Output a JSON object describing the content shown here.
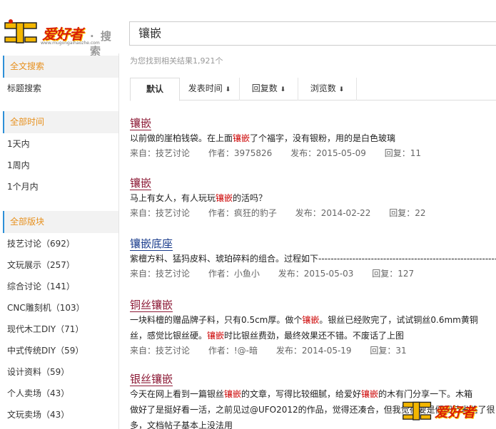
{
  "header": {
    "logo_text": "爱好者",
    "logo_url": "www.mugongaihaozhe.com",
    "search_label": "搜索",
    "search_value": "镶嵌"
  },
  "result_info": "为您找到相关结果1,921个",
  "sort": {
    "tabs": [
      {
        "label": "默认"
      },
      {
        "label": "发表时间"
      },
      {
        "label": "回复数"
      },
      {
        "label": "浏览数"
      }
    ],
    "arrow": "⬇"
  },
  "sidebar": {
    "groups": [
      {
        "items": [
          "全文搜索",
          "标题搜索"
        ]
      },
      {
        "items": [
          "全部时间",
          "1天内",
          "1周内",
          "1个月内"
        ]
      },
      {
        "items": [
          "全部版块",
          "技艺讨论（692）",
          "文玩展示（257）",
          "综合讨论（141）",
          "CNC雕刻机（103）",
          "现代木工DIY（71）",
          "中式传统DIY（59）",
          "设计资料（59）",
          "个人卖场（43）",
          "文玩卖场（43）"
        ]
      }
    ]
  },
  "results": [
    {
      "title_kw": "镶嵌",
      "title_rest": "",
      "snippet": [
        {
          "pre": "以前做的崖柏钱袋。在上面",
          "kw": "镶嵌",
          "post": "了个福字，没有银粉，用的是白色玻璃"
        }
      ],
      "from": "来自：技艺讨论",
      "author": "作者：3975826",
      "date": "发布：2015-05-09",
      "replies": "回复：11"
    },
    {
      "title_kw": "镶嵌",
      "title_rest": "",
      "snippet": [
        {
          "pre": "马上有女人，有人玩玩",
          "kw": "镶嵌",
          "post": "的活吗？"
        }
      ],
      "from": "来自：技艺讨论",
      "author": "作者：疯狂的豹子",
      "date": "发布：2014-02-22",
      "replies": "回复：22"
    },
    {
      "title_kw": "镶嵌",
      "title_rest": "底座",
      "snippet": [
        {
          "pre": "紫檀方料、猛犸皮料、琥珀碎料的组合。过程如下---------------------------------------------------------------------------",
          "kw": "",
          "post": ""
        }
      ],
      "from": "来自：技艺讨论",
      "author": "作者：小鱼小",
      "date": "发布：2015-05-03",
      "replies": "回复：127"
    },
    {
      "title_pre": "铜丝",
      "title_kw": "镶嵌",
      "snippet": [
        {
          "pre": "一块料檀的赠品牌子料，只有0.5cm厚。做个",
          "kw": "镶嵌",
          "post": "。银丝已经败完了，试试铜丝0.6mm黄铜"
        },
        {
          "pre": "丝，感觉比银丝硬。",
          "kw": "镶嵌",
          "post": "时比银丝费劲，最终效果还不错。不废话了上图"
        }
      ],
      "from": "来自：技艺讨论",
      "author": "作者：!@-暗",
      "date": "发布：2014-05-19",
      "replies": "回复：31"
    },
    {
      "title_pre": "银丝",
      "title_kw": "镶嵌",
      "snippet": [
        {
          "pre": "今天在网上看到一篇银丝",
          "kw": "镶嵌",
          "post": "的文章，写得比较细腻，给爱好",
          "kw2": "镶嵌",
          "post2": "的木有门分享一下。木箱"
        },
        {
          "pre": "做好了是挺好看一活，之前见过@UFO2012的作品，觉得还凑合，但我觉得要是们细节省略了很",
          "kw": "",
          "post": ""
        },
        {
          "pre": "多，文档帖子基本上没法用",
          "kw": "",
          "post": ""
        }
      ]
    }
  ]
}
